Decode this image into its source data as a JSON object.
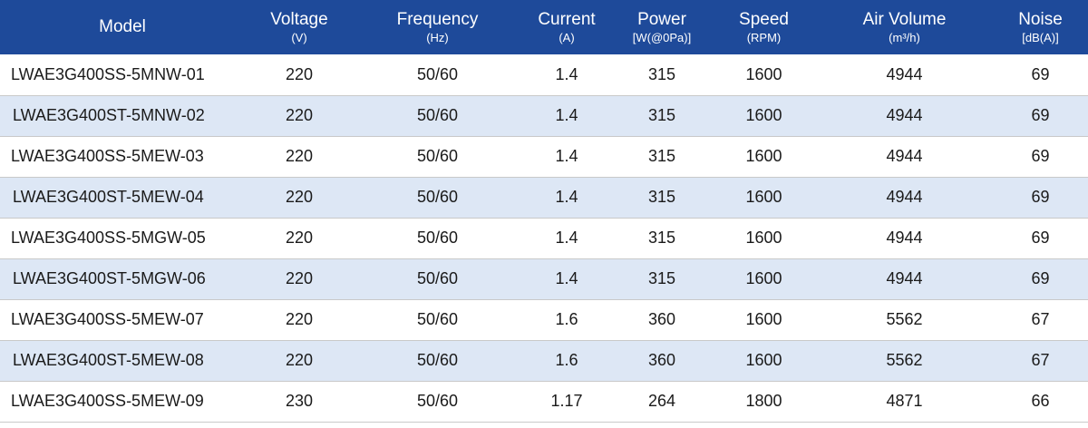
{
  "table": {
    "headers": [
      {
        "label": "Model",
        "unit": ""
      },
      {
        "label": "Voltage",
        "unit": "(V)"
      },
      {
        "label": "Frequency",
        "unit": "(Hz)"
      },
      {
        "label": "Current",
        "unit": "(A)"
      },
      {
        "label": "Power",
        "unit": "[W(@0Pa)]"
      },
      {
        "label": "Speed",
        "unit": "(RPM)"
      },
      {
        "label": "Air Volume",
        "unit": "(m³/h)"
      },
      {
        "label": "Noise",
        "unit": "[dB(A)]"
      }
    ],
    "rows": [
      [
        "LWAE3G400SS-5MNW-01",
        "220",
        "50/60",
        "1.4",
        "315",
        "1600",
        "4944",
        "69"
      ],
      [
        "LWAE3G400ST-5MNW-02",
        "220",
        "50/60",
        "1.4",
        "315",
        "1600",
        "4944",
        "69"
      ],
      [
        "LWAE3G400SS-5MEW-03",
        "220",
        "50/60",
        "1.4",
        "315",
        "1600",
        "4944",
        "69"
      ],
      [
        "LWAE3G400ST-5MEW-04",
        "220",
        "50/60",
        "1.4",
        "315",
        "1600",
        "4944",
        "69"
      ],
      [
        "LWAE3G400SS-5MGW-05",
        "220",
        "50/60",
        "1.4",
        "315",
        "1600",
        "4944",
        "69"
      ],
      [
        "LWAE3G400ST-5MGW-06",
        "220",
        "50/60",
        "1.4",
        "315",
        "1600",
        "4944",
        "69"
      ],
      [
        "LWAE3G400SS-5MEW-07",
        "220",
        "50/60",
        "1.6",
        "360",
        "1600",
        "5562",
        "67"
      ],
      [
        "LWAE3G400ST-5MEW-08",
        "220",
        "50/60",
        "1.6",
        "360",
        "1600",
        "5562",
        "67"
      ],
      [
        "LWAE3G400SS-5MEW-09",
        "230",
        "50/60",
        "1.17",
        "264",
        "1800",
        "4871",
        "66"
      ]
    ]
  },
  "colors": {
    "header_background": "#1e4a9a",
    "header_text": "#ffffff",
    "stripe_row": "#dde7f5",
    "plain_row": "#ffffff",
    "row_divider": "#c9c9c9"
  }
}
